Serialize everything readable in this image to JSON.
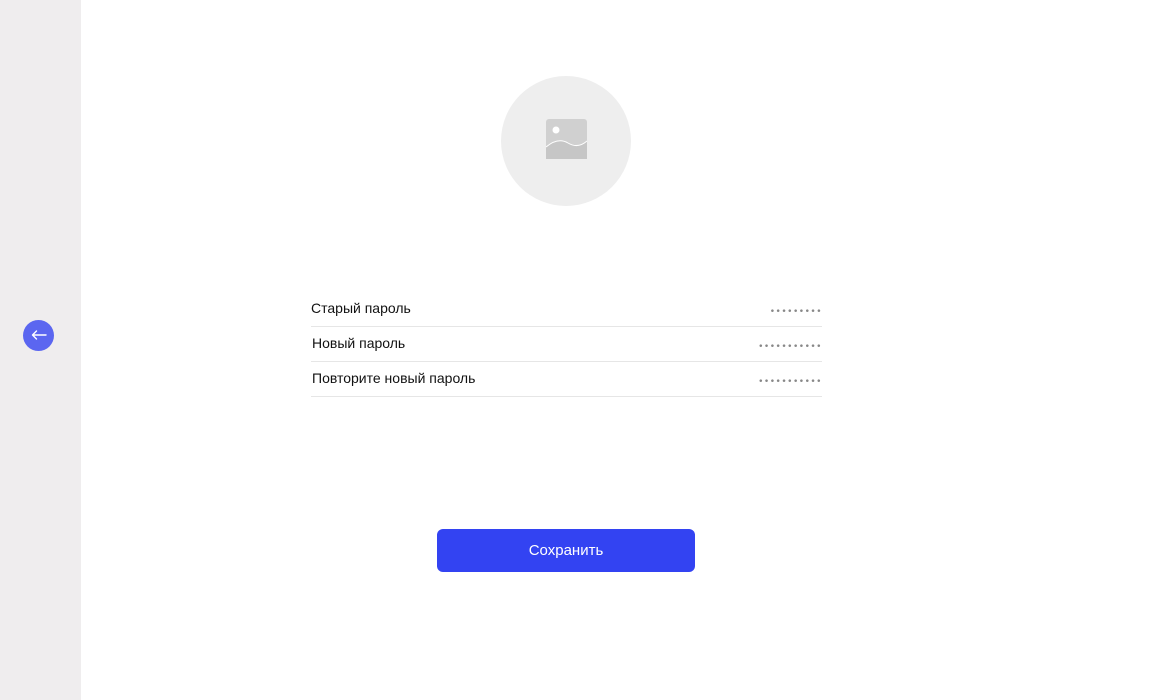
{
  "sidebar": {
    "back_icon": "arrow-left-icon"
  },
  "profile": {
    "avatar_icon": "image-placeholder-icon"
  },
  "form": {
    "rows": [
      {
        "label": "Старый пароль",
        "value": "•••••••••"
      },
      {
        "label": "Новый пароль",
        "value": "•••••••••••"
      },
      {
        "label": "Повторите новый пароль",
        "value": "•••••••••••"
      }
    ]
  },
  "actions": {
    "save_label": "Сохранить"
  },
  "colors": {
    "accent": "#3343f2",
    "back_button": "#5b66f0",
    "sidebar_bg": "#efedee"
  }
}
